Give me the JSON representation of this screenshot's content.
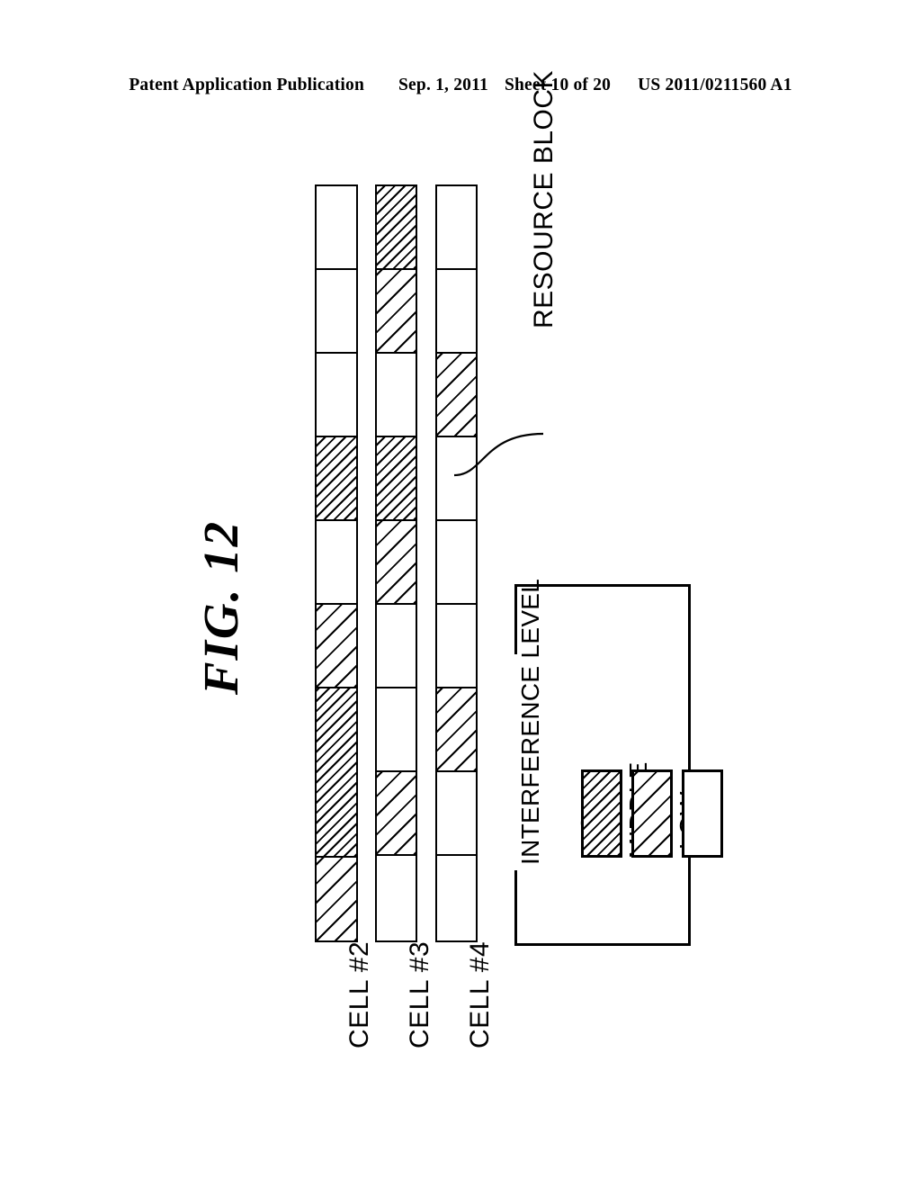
{
  "header": {
    "publication": "Patent Application Publication",
    "date": "Sep. 1, 2011",
    "sheet": "Sheet 10 of 20",
    "patent_number": "US 2011/0211560 A1"
  },
  "figure": {
    "label": "FIG. 12",
    "callout": {
      "text": "RESOURCE BLOCK",
      "points_to": "cell-4-block-4"
    }
  },
  "chart_data": {
    "type": "bar",
    "title": "FIG. 12",
    "description": "Resource block allocation map showing interference level per resource block for three cells",
    "xlabel": "",
    "ylabel": "",
    "legend_position": "bottom-right",
    "grid": false,
    "levels": [
      "HIGH",
      "MIDDLE",
      "LOW"
    ],
    "columns": [
      {
        "name": "CELL #2",
        "blocks": [
          {
            "index": 1,
            "level": "LOW"
          },
          {
            "index": 2,
            "level": "LOW"
          },
          {
            "index": 3,
            "level": "LOW"
          },
          {
            "index": 4,
            "level": "HIGH"
          },
          {
            "index": 5,
            "level": "LOW"
          },
          {
            "index": 6,
            "level": "MIDDLE"
          },
          {
            "index": 7,
            "level": "HIGH"
          },
          {
            "index": 8,
            "level": "MIDDLE"
          }
        ]
      },
      {
        "name": "CELL #3",
        "blocks": [
          {
            "index": 1,
            "level": "HIGH"
          },
          {
            "index": 2,
            "level": "MIDDLE"
          },
          {
            "index": 3,
            "level": "LOW"
          },
          {
            "index": 4,
            "level": "HIGH"
          },
          {
            "index": 5,
            "level": "MIDDLE"
          },
          {
            "index": 6,
            "level": "LOW"
          },
          {
            "index": 7,
            "level": "LOW"
          },
          {
            "index": 8,
            "level": "MIDDLE"
          },
          {
            "index": 9,
            "level": "LOW"
          }
        ]
      },
      {
        "name": "CELL #4",
        "blocks": [
          {
            "index": 1,
            "level": "LOW"
          },
          {
            "index": 2,
            "level": "LOW"
          },
          {
            "index": 3,
            "level": "MIDDLE"
          },
          {
            "index": 4,
            "level": "LOW"
          },
          {
            "index": 5,
            "level": "LOW"
          },
          {
            "index": 6,
            "level": "LOW"
          },
          {
            "index": 7,
            "level": "MIDDLE"
          },
          {
            "index": 8,
            "level": "LOW"
          },
          {
            "index": 9,
            "level": "LOW"
          }
        ]
      }
    ]
  },
  "cell_labels": {
    "cell2": "CELL #2",
    "cell3": "CELL #3",
    "cell4": "CELL #4"
  },
  "legend": {
    "title": "INTERFERENCE LEVEL",
    "entries": [
      {
        "label": "HIGH",
        "level": "HIGH"
      },
      {
        "label": "MIDDLE",
        "level": "MIDDLE"
      },
      {
        "label": "LOW",
        "level": "LOW"
      }
    ]
  }
}
